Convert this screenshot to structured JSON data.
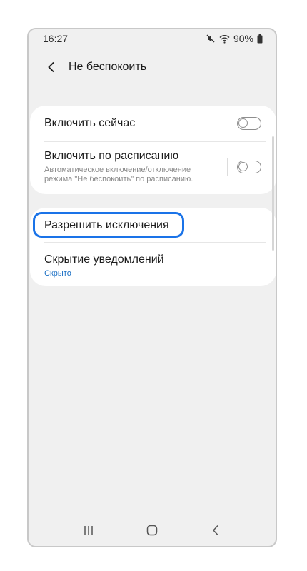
{
  "status": {
    "time": "16:27",
    "battery": "90%"
  },
  "header": {
    "title": "Не беспокоить"
  },
  "settings": {
    "enable_now": {
      "label": "Включить сейчас",
      "on": false
    },
    "schedule": {
      "label": "Включить по расписанию",
      "sub1": "Автоматическое включение/отключение",
      "sub2": "режима \"Не беспокоить\" по расписанию.",
      "on": false
    },
    "exceptions": {
      "label": "Разрешить исключения"
    },
    "hide_notifications": {
      "label": "Скрытие уведомлений",
      "value": "Скрыто"
    }
  },
  "colors": {
    "accent": "#1a73e8",
    "value_blue": "#1a6fc4",
    "background": "#f0f0f0"
  },
  "icons": {
    "mute": "mute-icon",
    "wifi": "wifi-icon",
    "battery": "battery-icon",
    "back": "back-icon",
    "recents": "recents-icon",
    "home": "home-icon",
    "nav_back": "nav-back-icon"
  }
}
